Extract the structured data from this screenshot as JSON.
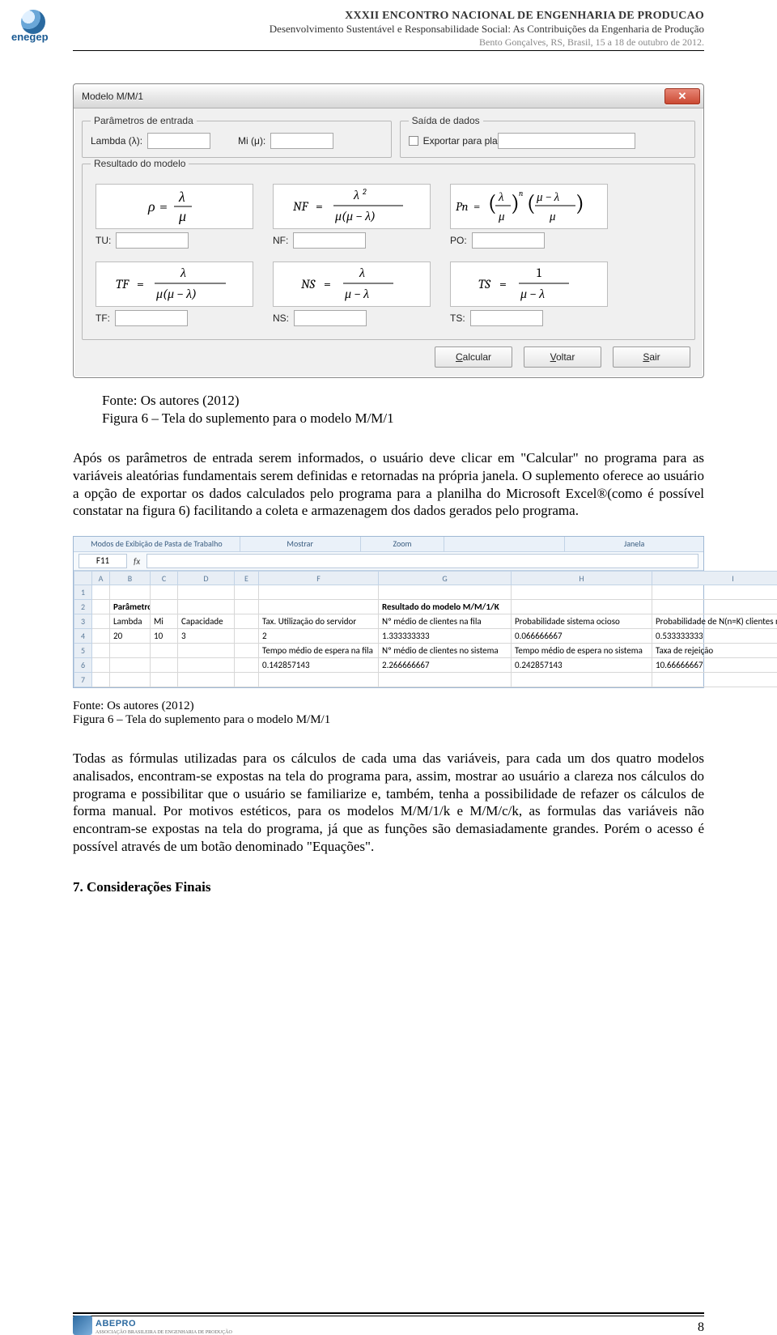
{
  "header": {
    "line1": "XXXII ENCONTRO NACIONAL DE ENGENHARIA DE PRODUCAO",
    "line2": "Desenvolvimento Sustentável e Responsabilidade Social: As Contribuições da Engenharia de Produção",
    "line3": "Bento Gonçalves, RS, Brasil, 15 a 18 de outubro de 2012.",
    "logo_label": "enegep"
  },
  "dialog": {
    "title": "Modelo M/M/1",
    "close_icon": "✕",
    "group_input": "Parâmetros de entrada",
    "group_output": "Saída de dados",
    "group_result": "Resultado do modelo",
    "lambda_label": "Lambda (λ):",
    "mi_label": "Mi (μ):",
    "export_label": "Exportar para planilha",
    "tu_label": "TU:",
    "nf_label": "NF:",
    "po_label": "PO:",
    "tf_label": "TF:",
    "ns_label": "NS:",
    "ts_label": "TS:",
    "btn_calcular": "Calcular",
    "btn_voltar": "Voltar",
    "btn_sair": "Sair"
  },
  "text": {
    "source1": "Fonte: Os autores (2012)",
    "figcap1": "Figura 6 – Tela do suplemento para o modelo M/M/1",
    "para1": "Após os parâmetros de entrada serem informados, o usuário deve clicar em \"Calcular\" no programa para as variáveis aleatórias fundamentais serem definidas e retornadas na própria janela. O suplemento oferece ao usuário a opção de exportar os dados calculados pelo programa para a planilha do Microsoft Excel®(como é possível constatar na figura 6) facilitando a coleta e armazenagem dos dados gerados pelo programa.",
    "source2": "Fonte: Os autores (2012)",
    "figcap2": "Figura 6 – Tela do suplemento para o modelo M/M/1",
    "para2": "Todas as fórmulas utilizadas para os cálculos de cada uma das variáveis, para cada um dos quatro modelos analisados, encontram-se expostas na tela do programa para, assim, mostrar ao usuário a clareza nos cálculos do programa e possibilitar que o usuário se familiarize e, também, tenha a possibilidade de refazer os cálculos de forma manual. Por motivos estéticos, para os modelos M/M/1/k e M/M/c/k, as formulas das variáveis não encontram-se expostas na tela do programa, já que as funções são demasiadamente grandes.  Porém o acesso é possível através de um botão denominado \"Equações\".",
    "h7": "7. Considerações Finais"
  },
  "excel": {
    "ribbon_groups": [
      "Modos de Exibição de Pasta de Trabalho",
      "Mostrar",
      "Zoom",
      "",
      "Janela"
    ],
    "namebox": "F11",
    "fx_label": "fx",
    "col_letters": [
      "A",
      "B",
      "C",
      "D",
      "E",
      "F",
      "G",
      "H",
      "I"
    ],
    "col_widths": [
      "22px",
      "50px",
      "34px",
      "70px",
      "30px",
      "148px",
      "164px",
      "174px",
      "200px"
    ],
    "rows": [
      {
        "n": "1",
        "cells": [
          "",
          "",
          "",
          "",
          "",
          "",
          "",
          "",
          ""
        ]
      },
      {
        "n": "2",
        "cells": [
          "",
          "Parâmetros de entrada§b",
          "",
          "",
          "",
          "",
          "Resultado do modelo M/M/1/K§b",
          "",
          ""
        ]
      },
      {
        "n": "3",
        "cells": [
          "",
          "Lambda",
          "Mi",
          "Capacidade",
          "",
          "Tax. Utilização do servidor",
          "Nº médio de clientes na fila",
          "Probabilidade sistema ocioso",
          "Probabilidade de N(n=K) clientes no sitema"
        ]
      },
      {
        "n": "4",
        "cells": [
          "",
          "20",
          "10",
          "3",
          "",
          "2",
          "1.333333333",
          "0.066666667",
          "0.533333333"
        ]
      },
      {
        "n": "5",
        "cells": [
          "",
          "",
          "",
          "",
          "",
          "Tempo médio de espera na fila",
          "Nº médio de clientes no sistema",
          "Tempo médio de espera no sistema",
          "Taxa de rejeição"
        ]
      },
      {
        "n": "6",
        "cells": [
          "",
          "",
          "",
          "",
          "",
          "0.142857143",
          "2.266666667",
          "0.242857143",
          "10.66666667"
        ]
      },
      {
        "n": "7",
        "cells": [
          "",
          "",
          "",
          "",
          "",
          "",
          "",
          "",
          ""
        ]
      }
    ]
  },
  "chart_data": {
    "type": "table",
    "title": "Resultado do modelo M/M/1/K",
    "input": {
      "Lambda": 20,
      "Mi": 10,
      "Capacidade": 3
    },
    "output": {
      "Tax. Utilização do servidor": 2,
      "Nº médio de clientes na fila": 1.333333333,
      "Probabilidade sistema ocioso": 0.066666667,
      "Probabilidade de N(n=K) clientes no sistema": 0.533333333,
      "Tempo médio de espera na fila": 0.142857143,
      "Nº médio de clientes no sistema": 2.266666667,
      "Tempo médio de espera no sistema": 0.242857143,
      "Taxa de rejeição": 10.66666667
    }
  },
  "footer": {
    "page": "8",
    "abepro_text": "ABEPRO",
    "abepro_sub": "ASSOCIAÇÃO BRASILEIRA DE ENGENHARIA DE PRODUÇÃO"
  }
}
